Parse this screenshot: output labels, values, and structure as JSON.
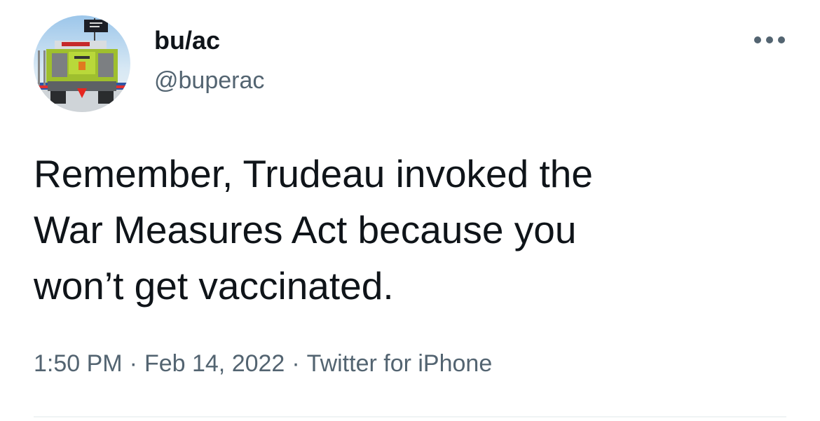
{
  "tweet": {
    "author": {
      "display_name": "bu/ac",
      "handle": "@buperac",
      "avatar_icon": "combine-harvester-avatar"
    },
    "more_icon": "more-options-icon",
    "body_lines": [
      "Remember, Trudeau invoked the",
      "War Measures Act because you",
      "won’t get vaccinated."
    ],
    "meta": {
      "time": "1:50 PM",
      "date": "Feb 14, 2022",
      "source": "Twitter for iPhone",
      "separator": "·"
    }
  },
  "colors": {
    "text_primary": "#0f1419",
    "text_secondary": "#536471",
    "divider": "#eff3f4"
  }
}
